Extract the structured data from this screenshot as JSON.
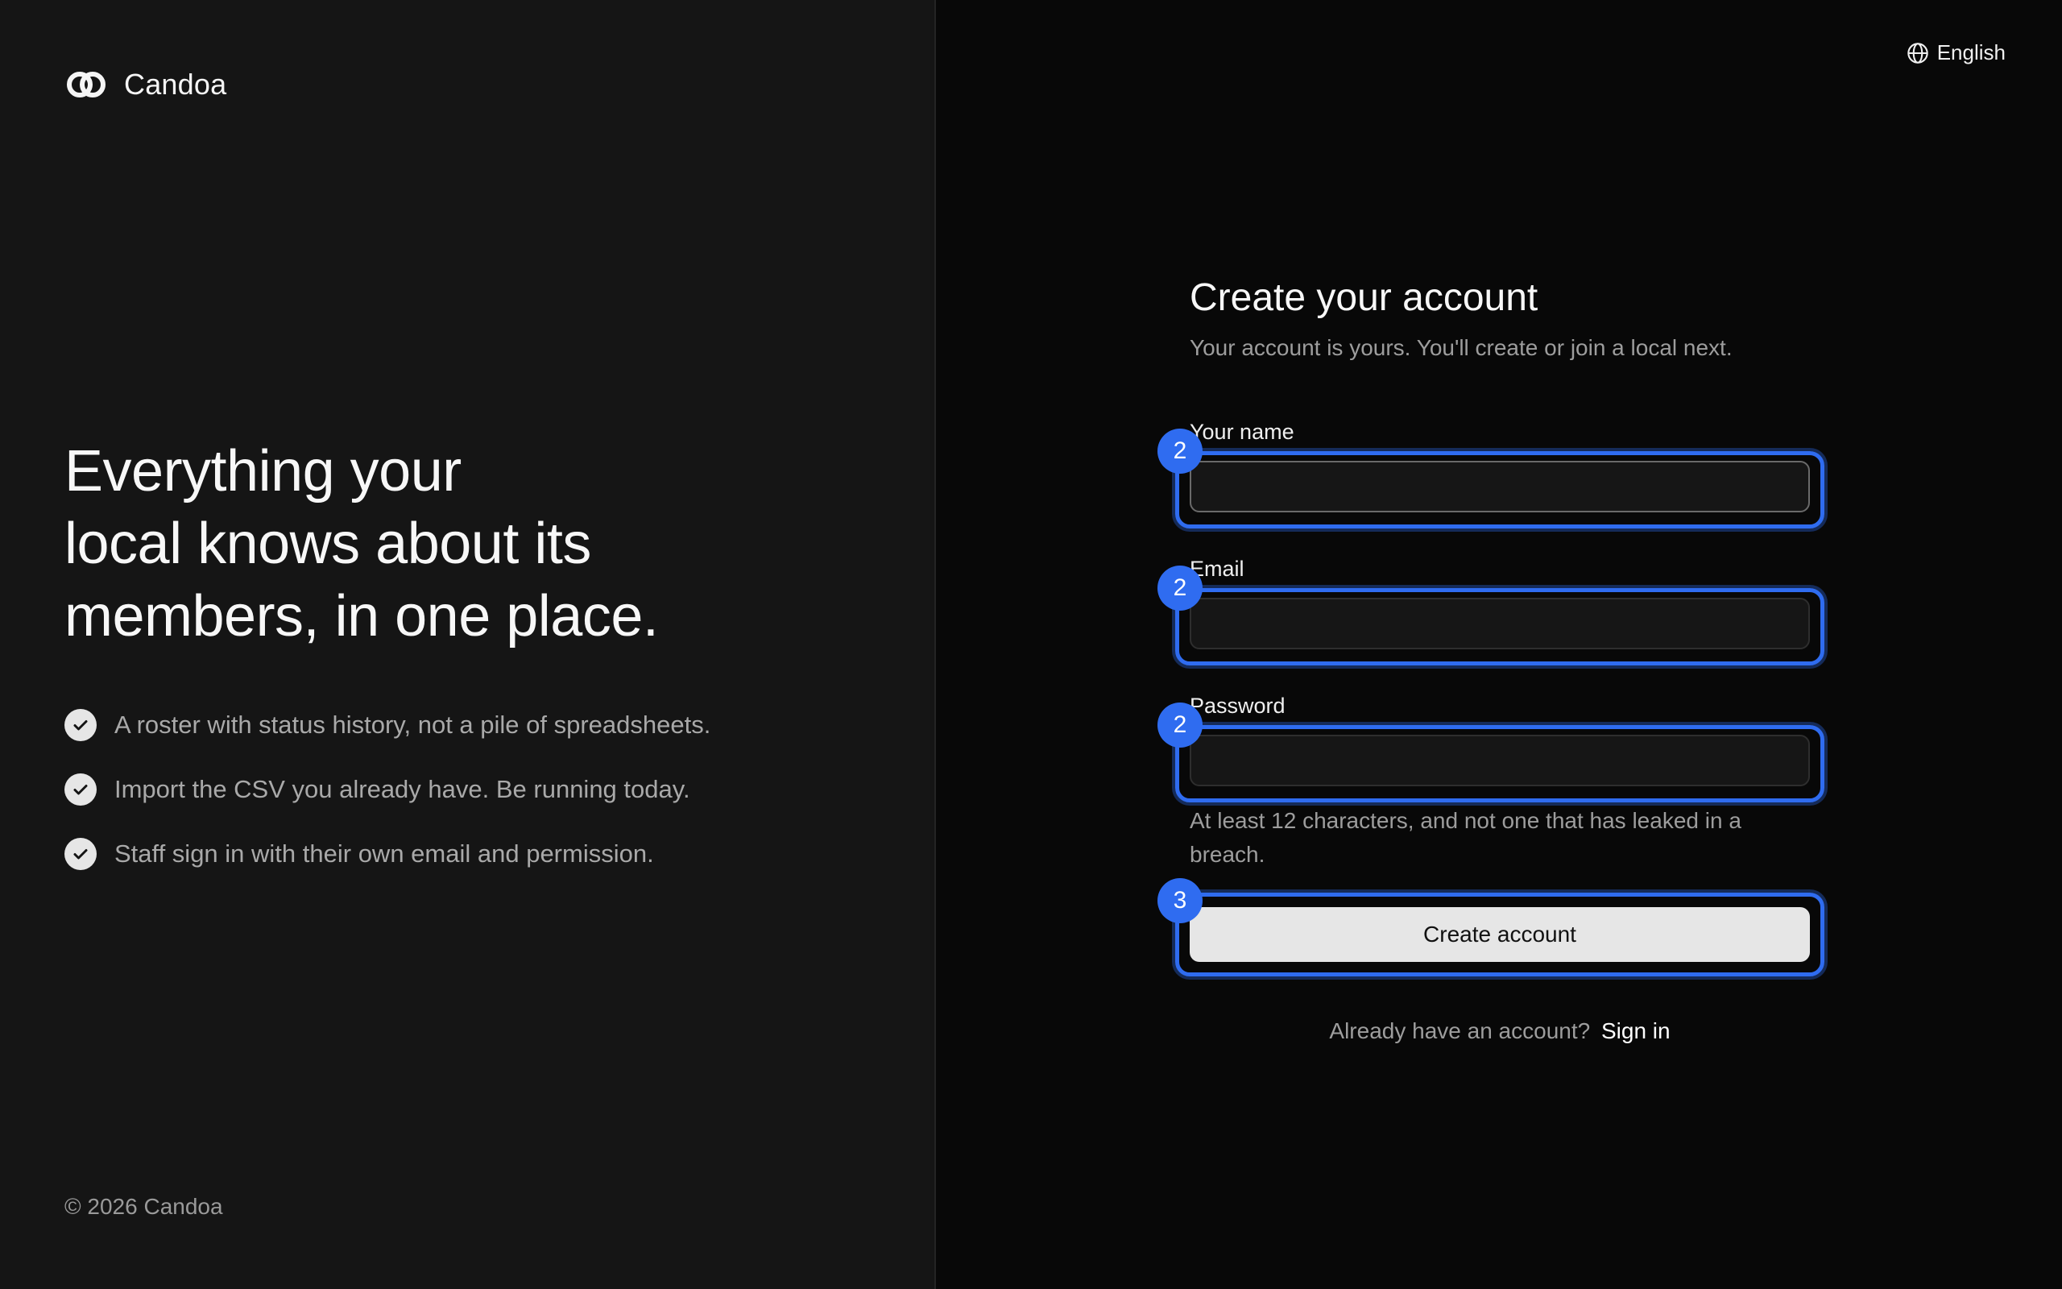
{
  "brand": {
    "name": "Candoa",
    "logo_icon": "interlocking-rings-icon"
  },
  "hero": {
    "lines": [
      "Everything your",
      "local knows about its",
      "members, in one place."
    ]
  },
  "features": [
    {
      "icon": "check-icon",
      "text": "A roster with status history, not a pile of spreadsheets."
    },
    {
      "icon": "check-icon",
      "text": "Import the CSV you already have. Be running today."
    },
    {
      "icon": "check-icon",
      "text": "Staff sign in with their own email and permission."
    }
  ],
  "footer": {
    "copyright": "© 2026 Candoa"
  },
  "language": {
    "icon": "globe-icon",
    "label": "English"
  },
  "form": {
    "title": "Create your account",
    "subtitle": "Your account is yours. You'll create or join a local next.",
    "fields": {
      "name": {
        "label": "Your name",
        "value": "",
        "badge": "2"
      },
      "email": {
        "label": "Email",
        "value": "",
        "badge": "2"
      },
      "password": {
        "label": "Password",
        "value": "",
        "badge": "2"
      }
    },
    "password_help": "At least 12 characters, and not one that has leaked in a breach.",
    "submit": {
      "label": "Create account",
      "badge": "3"
    },
    "signin": {
      "prompt": "Already have an account?",
      "link": "Sign in"
    }
  },
  "colors": {
    "accent": "#2f6cf0",
    "left_bg": "#151515",
    "right_bg": "#080808",
    "button_bg": "#e6e6e6"
  }
}
